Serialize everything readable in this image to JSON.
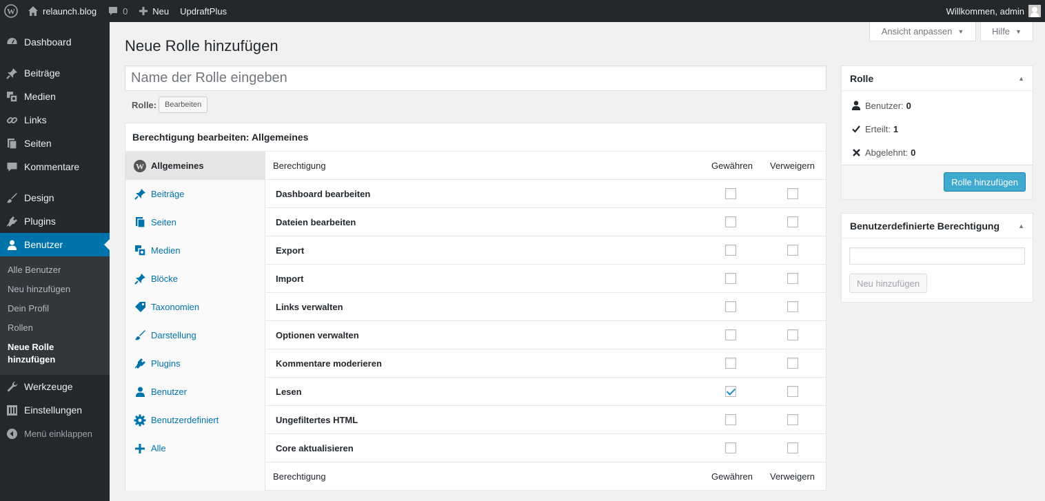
{
  "adminbar": {
    "site_name": "relaunch.blog",
    "comments_count": "0",
    "new_label": "Neu",
    "plugin_label": "UpdraftPlus",
    "welcome": "Willkommen, admin"
  },
  "sidebar": {
    "items": [
      {
        "label": "Dashboard",
        "icon": "dashboard-icon"
      },
      {
        "label": "Beiträge",
        "icon": "pin-icon"
      },
      {
        "label": "Medien",
        "icon": "media-icon"
      },
      {
        "label": "Links",
        "icon": "link-icon"
      },
      {
        "label": "Seiten",
        "icon": "pages-icon"
      },
      {
        "label": "Kommentare",
        "icon": "comment-icon"
      },
      {
        "label": "Design",
        "icon": "brush-icon"
      },
      {
        "label": "Plugins",
        "icon": "plugin-icon"
      },
      {
        "label": "Benutzer",
        "icon": "user-icon"
      },
      {
        "label": "Werkzeuge",
        "icon": "wrench-icon"
      },
      {
        "label": "Einstellungen",
        "icon": "settings-icon"
      },
      {
        "label": "Menü einklappen",
        "icon": "collapse-icon"
      }
    ],
    "submenu": [
      "Alle Benutzer",
      "Neu hinzufügen",
      "Dein Profil",
      "Rollen",
      "Neue Rolle hinzufügen"
    ]
  },
  "screen_meta": {
    "options_label": "Ansicht anpassen",
    "help_label": "Hilfe"
  },
  "page": {
    "title": "Neue Rolle hinzufügen",
    "role_name_placeholder": "Name der Rolle eingeben",
    "role_label": "Rolle:",
    "edit_label": "Bearbeiten"
  },
  "caps": {
    "box_title": "Berechtigung bearbeiten: Allgemeines",
    "tabs": [
      "Allgemeines",
      "Beiträge",
      "Seiten",
      "Medien",
      "Blöcke",
      "Taxonomien",
      "Darstellung",
      "Plugins",
      "Benutzer",
      "Benutzerdefiniert",
      "Alle"
    ],
    "col_capability": "Berechtigung",
    "col_grant": "Gewähren",
    "col_deny": "Verweigern",
    "rows": [
      {
        "name": "Dashboard bearbeiten",
        "grant": false,
        "deny": false
      },
      {
        "name": "Dateien bearbeiten",
        "grant": false,
        "deny": false
      },
      {
        "name": "Export",
        "grant": false,
        "deny": false
      },
      {
        "name": "Import",
        "grant": false,
        "deny": false
      },
      {
        "name": "Links verwalten",
        "grant": false,
        "deny": false
      },
      {
        "name": "Optionen verwalten",
        "grant": false,
        "deny": false
      },
      {
        "name": "Kommentare moderieren",
        "grant": false,
        "deny": false
      },
      {
        "name": "Lesen",
        "grant": true,
        "deny": false
      },
      {
        "name": "Ungefiltertes HTML",
        "grant": false,
        "deny": false
      },
      {
        "name": "Core aktualisieren",
        "grant": false,
        "deny": false
      }
    ]
  },
  "role_box": {
    "title": "Rolle",
    "users_label": "Benutzer:",
    "users_value": "0",
    "granted_label": "Erteilt:",
    "granted_value": "1",
    "denied_label": "Abgelehnt:",
    "denied_value": "0",
    "submit_label": "Rolle hinzufügen"
  },
  "custom_box": {
    "title": "Benutzerdefinierte Berechtigung",
    "add_label": "Neu hinzufügen"
  },
  "colors": {
    "accent": "#0073aa",
    "sidebar_bg": "#23282d",
    "primary_button": "#2ea2cc"
  }
}
